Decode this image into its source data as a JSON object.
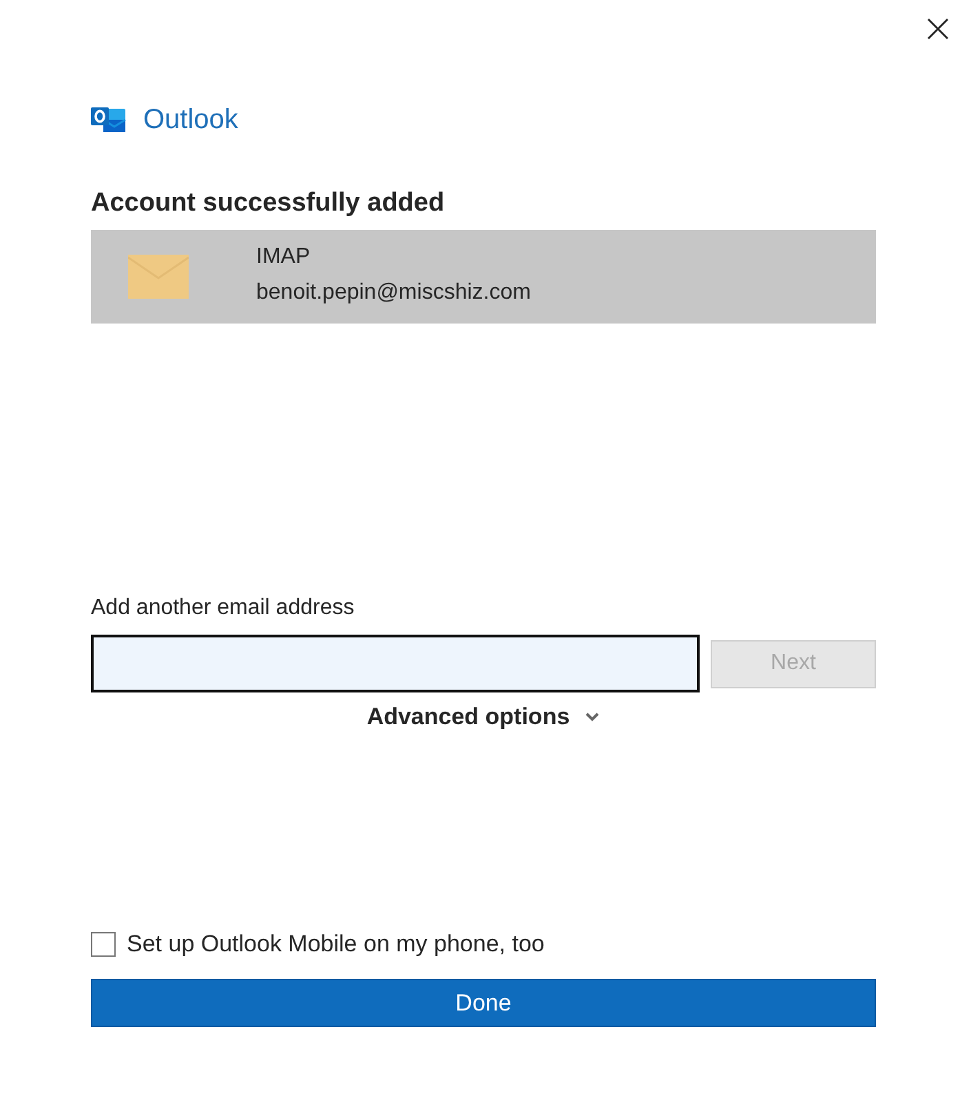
{
  "app": {
    "name": "Outlook"
  },
  "heading": "Account successfully added",
  "accounts": [
    {
      "type": "IMAP",
      "email": "benoit.pepin@miscshiz.com",
      "selected": true
    }
  ],
  "add_email": {
    "label": "Add another email address",
    "focused": true
  },
  "next_button": {
    "label": "Next",
    "disabled": true
  },
  "advanced_options": {
    "label": "Advanced options",
    "expanded": false
  },
  "mobile_setup": {
    "label": "Set up Outlook Mobile on my phone, too",
    "checked": false
  },
  "done_button": {
    "label": "Done"
  }
}
